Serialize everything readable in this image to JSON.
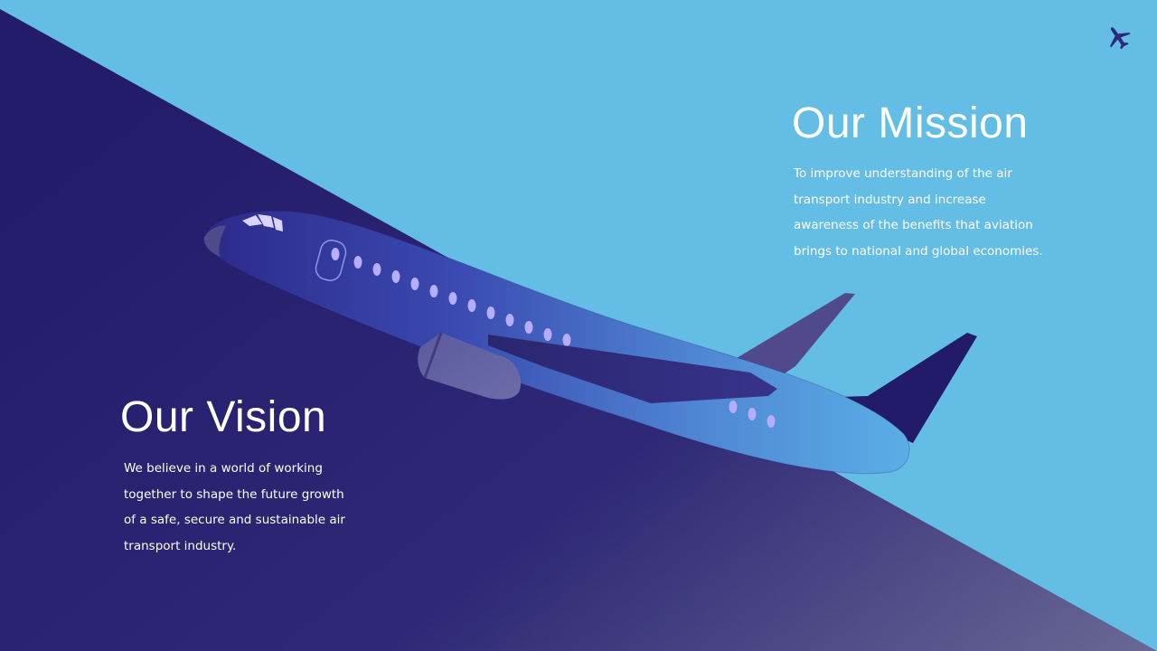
{
  "mission": {
    "title": "Our Mission",
    "lines": [
      "To improve understanding of the air",
      "transport industry and increase",
      "awareness  of the benefits that aviation",
      "brings to national and global economies."
    ]
  },
  "vision": {
    "title": "Our Vision",
    "lines": [
      "We believe in a world of working",
      "together to shape the future growth",
      "of a safe, secure and sustainable air",
      "transport industry."
    ]
  },
  "icons": {
    "logo": "airplane-icon",
    "illustration": "airplane-illustration"
  },
  "colors": {
    "sky": "#63bde5",
    "navy": "#23206e",
    "text": "#ffffff"
  }
}
